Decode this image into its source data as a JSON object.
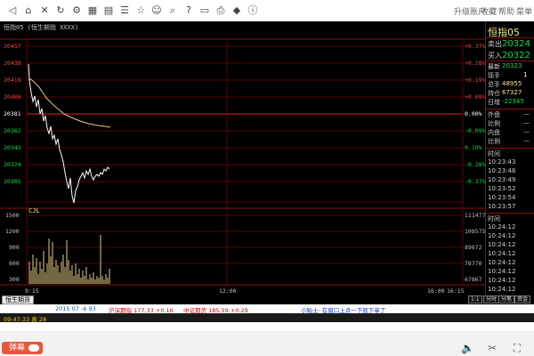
{
  "toolbar": {
    "menus": [
      "升级账户",
      "收藏",
      "帮助",
      "菜单"
    ]
  },
  "window": {
    "title": "恒指05  (恒生期指  XXXX)"
  },
  "chart": {
    "price_labels": [
      "20457",
      "20438",
      "20419",
      "20400",
      "20381",
      "20362",
      "20343",
      "20324",
      "20305"
    ],
    "pct_labels": [
      "+0.37%",
      "+0.28%",
      "+0.19%",
      "+0.09%",
      "0.00%",
      "-0.09%",
      "0.19%",
      "-0.28%",
      "-0.37%"
    ],
    "vol_tag": "CJL",
    "vol_left_labels": [
      "1500",
      "1200",
      "900",
      "600",
      "300"
    ],
    "vol_right_labels": [
      "111477",
      "108575",
      "89672",
      "78770",
      "67867"
    ],
    "time_labels": [
      "9:15",
      "12:00",
      "16:00",
      "16:15"
    ]
  },
  "quote": {
    "title": "恒指05",
    "sell": {
      "label": "卖出",
      "value": "20324"
    },
    "buy": {
      "label": "买入",
      "value": "20322"
    },
    "latest": {
      "label": "最新",
      "value": "20323"
    },
    "current_hand": {
      "label": "现手",
      "value": "1"
    },
    "total_hand": {
      "label": "总手",
      "value": "48955"
    },
    "open_interest": {
      "label": "持仓",
      "value": "67327"
    },
    "daily_change": {
      "label": "日增",
      "value": "-22345"
    },
    "outer": {
      "label": "外盘",
      "value": "—"
    },
    "ratio1": {
      "label": "比例",
      "value": "—"
    },
    "inner": {
      "label": "内盘",
      "value": "—"
    },
    "ratio2": {
      "label": "比例",
      "value": "—"
    },
    "time_header": "时间",
    "ticks1": [
      "10:23:43",
      "10:23:46",
      "10:23:49",
      "10:23:52",
      "10:23:54",
      "10:23:57"
    ],
    "ticks2": [
      "10:24:12",
      "10:24:12",
      "10:24:12",
      "10:24:12",
      "10:24:12",
      "10:24:12",
      "10:24:12",
      "10:24:12",
      "10:24:12"
    ]
  },
  "tabs": {
    "active": "恒生期货",
    "right_buttons": [
      "1:1",
      "分时",
      "分笔",
      "资金"
    ],
    "quote_buttons": [
      "明细",
      "分价"
    ]
  },
  "ticker": [
    {
      "text": "09:47:33  真  28",
      "color": "#0055cc"
    },
    {
      "text": "2015  07  -6  93",
      "color": "#0055cc"
    },
    {
      "text": "沪深期指  177.33  +0.16",
      "color": "#cc0000"
    },
    {
      "text": "中证期货  185.59  +0.29",
      "color": "#cc0000"
    },
    {
      "text": "小贴士: 在窗口上点一下就下单了",
      "color": "#0033cc"
    }
  ],
  "player": {
    "danmu_label": "弹幕"
  }
}
